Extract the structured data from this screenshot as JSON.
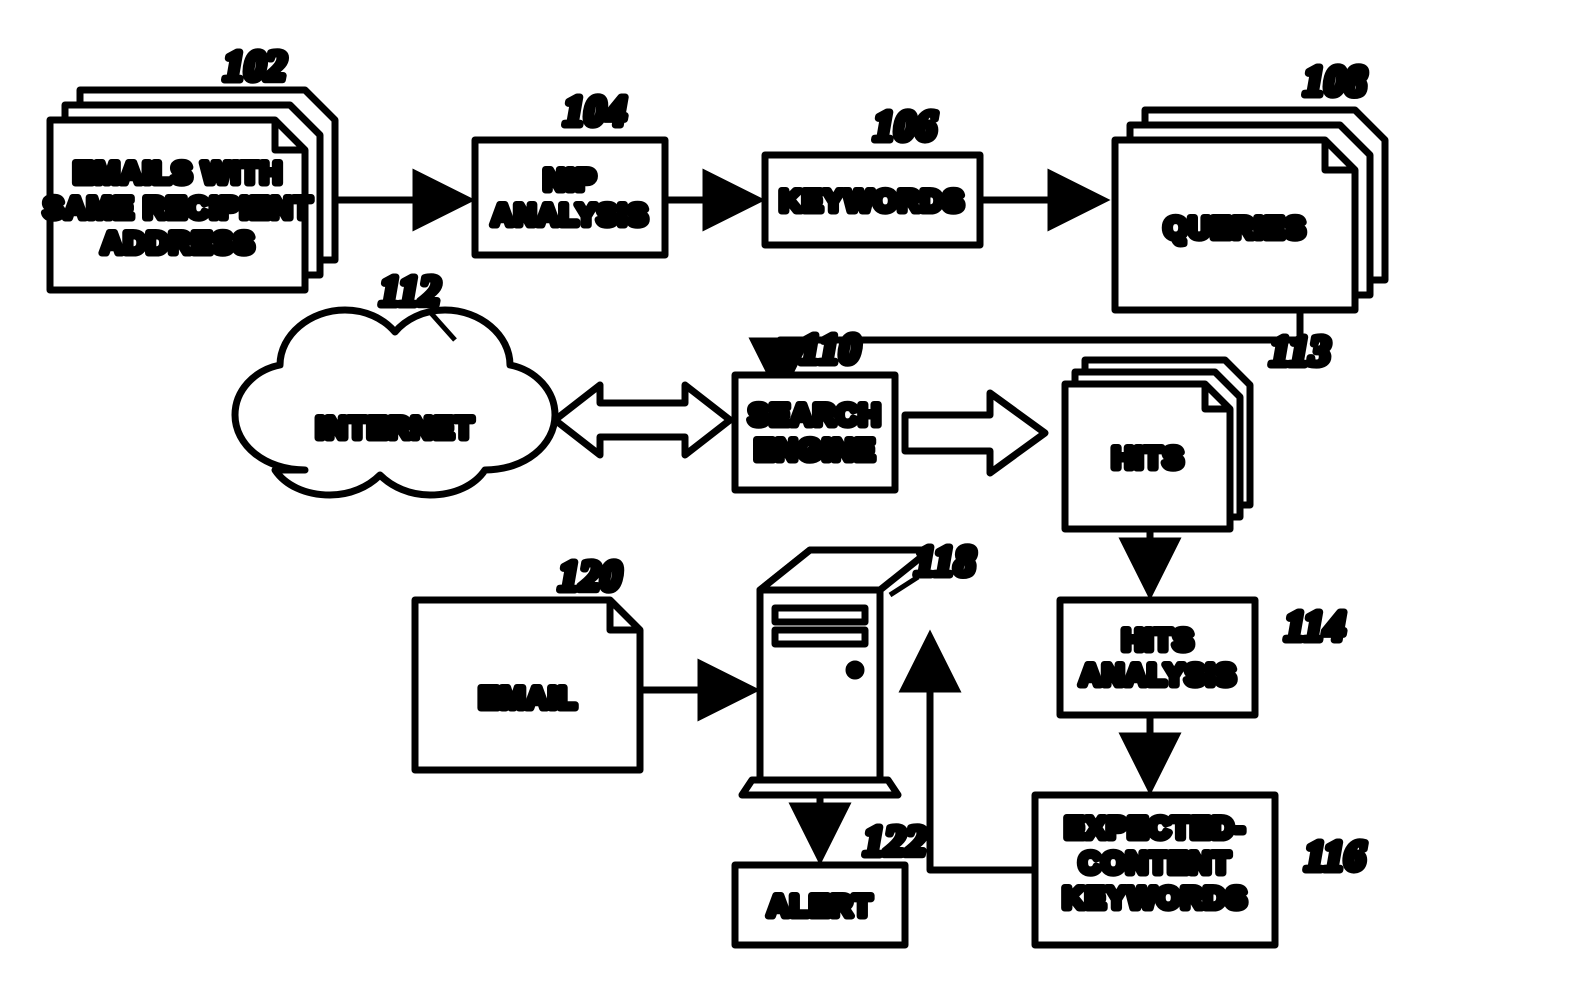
{
  "nodes": {
    "emails": {
      "ref": "102",
      "lines": [
        "EMAILS WITH",
        "SAME RECIPIENT",
        "ADDRESS"
      ]
    },
    "nip": {
      "ref": "104",
      "lines": [
        "NIP",
        "ANALYSIS"
      ]
    },
    "keywords": {
      "ref": "106",
      "lines": [
        "KEYWORDS"
      ]
    },
    "queries": {
      "ref": "108",
      "lines": [
        "QUERIES"
      ]
    },
    "internet": {
      "ref": "112",
      "lines": [
        "INTERNET"
      ]
    },
    "search": {
      "ref": "110",
      "lines": [
        "SEARCH",
        "ENGINE"
      ]
    },
    "hits": {
      "ref": "113",
      "lines": [
        "HITS"
      ]
    },
    "hitsA": {
      "ref": "114",
      "lines": [
        "HITS",
        "ANALYSIS"
      ]
    },
    "expected": {
      "ref": "116",
      "lines": [
        "EXPECTED-",
        "CONTENT",
        "KEYWORDS"
      ]
    },
    "email": {
      "ref": "120",
      "lines": [
        "EMAIL"
      ]
    },
    "server": {
      "ref": "118",
      "lines": []
    },
    "alert": {
      "ref": "122",
      "lines": [
        "ALERT"
      ]
    }
  }
}
